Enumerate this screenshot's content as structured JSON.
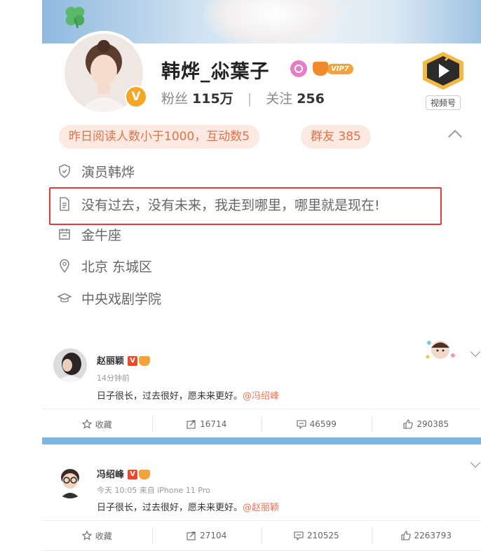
{
  "profile": {
    "name": "韩烨_尛葉子",
    "vip_level": "VIP7",
    "fans_label": "粉丝",
    "fans_count": "115万",
    "follow_label": "关注",
    "follow_count": "256",
    "video_label": "视频号",
    "pill_reading": "昨日阅读人数小于1000，互动数5",
    "pill_group": "群友 385",
    "info": {
      "verification": "演员韩烨",
      "bio": "没有过去，没有未来，我走到哪里，哪里就是现在!",
      "zodiac": "金牛座",
      "location": "北京 东城区",
      "school": "中央戏剧学院"
    }
  },
  "posts": [
    {
      "author": "赵丽颖",
      "time": "14分钟前",
      "text": "日子很长，过去很好，愿未来更好。",
      "mention": "@冯绍峰",
      "actions": {
        "fav": "收藏",
        "repost": "16714",
        "comment": "46599",
        "like": "290385"
      }
    },
    {
      "author": "冯绍峰",
      "time": "今天 10:05 来自 iPhone 11 Pro",
      "text": "日子很长，过去很好，愿未来更好。",
      "mention": "@赵丽颖",
      "actions": {
        "fav": "收藏",
        "repost": "27104",
        "comment": "210525",
        "like": "2263793"
      }
    }
  ],
  "colors": {
    "accent_orange": "#e0734a",
    "pill_bg": "#fbe9e2",
    "highlight_red": "#e03c3c",
    "divider_blue": "#7fb6de",
    "verified_gold": "#f5a623"
  }
}
